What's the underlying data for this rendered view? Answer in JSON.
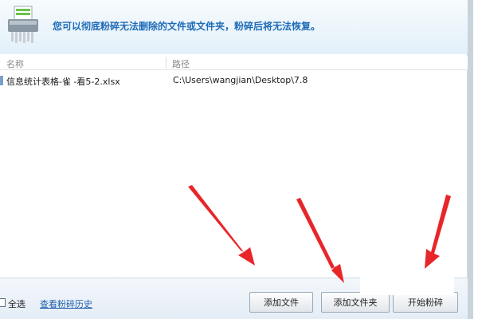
{
  "header": {
    "description": "您可以彻底粉碎无法删除的文件或文件夹，粉碎后将无法恢复。",
    "icon": "shredder-icon"
  },
  "table": {
    "columns": [
      "名称",
      "路径"
    ],
    "rows": [
      {
        "name": "信息统计表格-雀 -看5-2.xlsx",
        "path": "C:\\Users\\wangjian\\Desktop\\7.8"
      }
    ]
  },
  "footer": {
    "select_all_label": "全选",
    "history_link": "查看粉碎历史",
    "add_file_button": "添加文件",
    "add_folder_button": "添加文件夹",
    "start_button": "开始粉碎"
  },
  "colors": {
    "header_text": "#1e6bb8",
    "annotation_arrow": "#e8262a"
  }
}
